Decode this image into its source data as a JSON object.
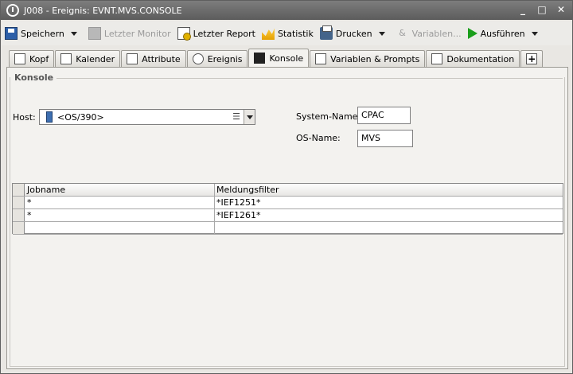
{
  "window": {
    "title": "J008 - Ereignis: EVNT.MVS.CONSOLE",
    "controls": {
      "minimize": "_",
      "maximize": "□",
      "close": "✕"
    }
  },
  "toolbar": {
    "save": "Speichern",
    "last_monitor": "Letzter Monitor",
    "last_report": "Letzter Report",
    "statistics": "Statistik",
    "print": "Drucken",
    "variables": "Variablen...",
    "execute": "Ausführen"
  },
  "tabs": [
    {
      "label": "Kopf"
    },
    {
      "label": "Kalender"
    },
    {
      "label": "Attribute"
    },
    {
      "label": "Ereignis"
    },
    {
      "label": "Konsole"
    },
    {
      "label": "Variablen & Prompts"
    },
    {
      "label": "Dokumentation"
    }
  ],
  "active_tab": "Konsole",
  "console": {
    "group_title": "Konsole",
    "host_label": "Host:",
    "host_value": "<OS/390>",
    "system_name_label": "System-Name:",
    "system_name_value": "CPAC",
    "os_name_label": "OS-Name:",
    "os_name_value": "MVS"
  },
  "table": {
    "columns": [
      "Jobname",
      "Meldungsfilter"
    ],
    "rows": [
      [
        "*",
        "*IEF1251*"
      ],
      [
        "*",
        "*IEF1261*"
      ],
      [
        "",
        ""
      ]
    ]
  }
}
